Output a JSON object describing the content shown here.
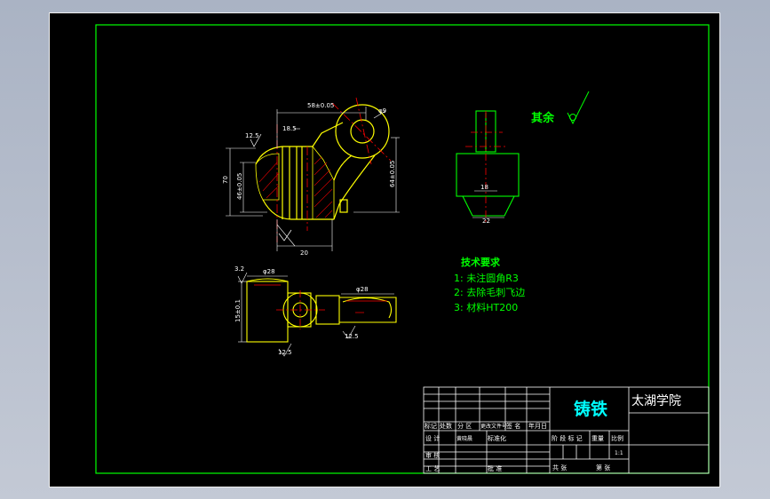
{
  "tech_requirements": {
    "title": "技术要求",
    "items": [
      "1: 未注圆角R3",
      "2: 去除毛刺飞边",
      "3: 材料HT200"
    ]
  },
  "surface_note": {
    "label": "其余"
  },
  "title_block": {
    "part_name": "铸铁",
    "school": "太湖学院",
    "header_row": [
      "标记",
      "处数",
      "分 区",
      "更改文件号",
      "签 名",
      "年月日"
    ],
    "rows": [
      {
        "role": "设 计",
        "name": "黄晓晨",
        "mark": "标准化"
      },
      {
        "role": "审 核"
      },
      {
        "role": "工 艺",
        "mark": "批 准"
      }
    ],
    "right_headers": [
      "阶 段 标 记",
      "重量",
      "比例"
    ],
    "scale": "1:1",
    "sheet_total_label": "共  张",
    "sheet_no_label": "第  张"
  },
  "dimensions": {
    "top_width": "58±0.05",
    "top_small": "18.5",
    "roughness_top": "12.5",
    "left_outer": "70",
    "left_inner": "46±0.05",
    "right_height": "64±0.05",
    "hole_dia": "φ9",
    "bottom_width": "20",
    "side_width": "18",
    "side_bottom": "22",
    "plan_left_dia": "φ28",
    "plan_right_dia": "φ28",
    "plan_height": "15±0.1",
    "plan_roughness": "3.2",
    "plan_rough_bottom": "12.5",
    "plan_rough_right": "12.5"
  },
  "colors": {
    "background": "#000000",
    "border": "#00ff00",
    "outline": "#ffff00",
    "center": "#ff0000",
    "text_green": "#00ff00",
    "text_cyan": "#00ffff",
    "dim": "#ffffff"
  }
}
